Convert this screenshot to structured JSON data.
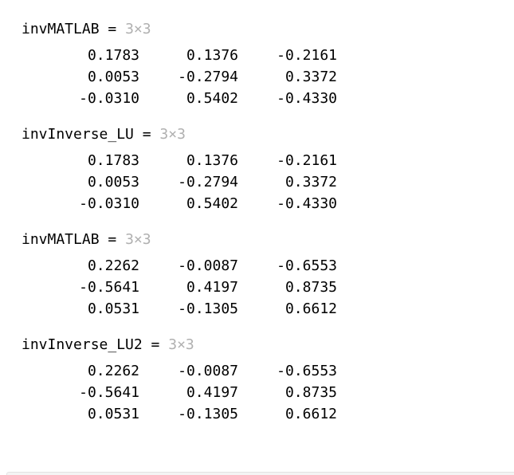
{
  "blocks": [
    {
      "name": "invMATLAB",
      "equals": " = ",
      "size": "3×3",
      "rows": [
        [
          "0.1783",
          "0.1376",
          "-0.2161"
        ],
        [
          "0.0053",
          "-0.2794",
          "0.3372"
        ],
        [
          "-0.0310",
          "0.5402",
          "-0.4330"
        ]
      ]
    },
    {
      "name": "invInverse_LU",
      "equals": " = ",
      "size": "3×3",
      "rows": [
        [
          "0.1783",
          "0.1376",
          "-0.2161"
        ],
        [
          "0.0053",
          "-0.2794",
          "0.3372"
        ],
        [
          "-0.0310",
          "0.5402",
          "-0.4330"
        ]
      ]
    },
    {
      "name": "invMATLAB",
      "equals": " = ",
      "size": "3×3",
      "rows": [
        [
          "0.2262",
          "-0.0087",
          "-0.6553"
        ],
        [
          "-0.5641",
          "0.4197",
          "0.8735"
        ],
        [
          "0.0531",
          "-0.1305",
          "0.6612"
        ]
      ]
    },
    {
      "name": "invInverse_LU2",
      "equals": " = ",
      "size": "3×3",
      "rows": [
        [
          "0.2262",
          "-0.0087",
          "-0.6553"
        ],
        [
          "-0.5641",
          "0.4197",
          "0.8735"
        ],
        [
          "0.0531",
          "-0.1305",
          "0.6612"
        ]
      ]
    }
  ],
  "colors": {
    "text": "#000000",
    "dimension_label": "#b0b0b0",
    "background": "#ffffff"
  }
}
